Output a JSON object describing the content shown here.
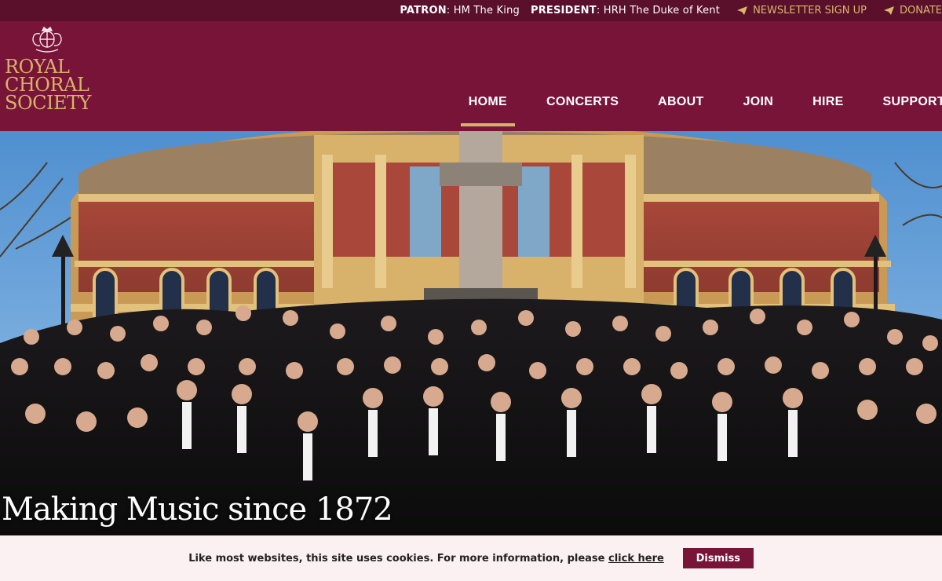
{
  "topbar": {
    "patron_label": "PATRON",
    "patron_value": ": HM The King",
    "president_label": "PRESIDENT",
    "president_value": ": HRH The Duke of Kent",
    "newsletter": "NEWSLETTER SIGN UP",
    "donate": "DONATE"
  },
  "logo": {
    "line1": "ROYAL",
    "line2": "CHORAL",
    "line3": "SOCIETY"
  },
  "nav": {
    "items": [
      "HOME",
      "CONCERTS",
      "ABOUT",
      "JOIN",
      "HIRE",
      "SUPPORT"
    ],
    "active": "HOME"
  },
  "hero": {
    "title": "Making Music since 1872"
  },
  "cookie": {
    "message": "Like most websites, this site uses cookies. For more information, please ",
    "link": "click here",
    "dismiss": "Dismiss"
  },
  "colors": {
    "brand": "#781438",
    "topbar": "#5a0f2a",
    "gold": "#d6b36a",
    "cookie_bg": "#fbf0f2"
  }
}
